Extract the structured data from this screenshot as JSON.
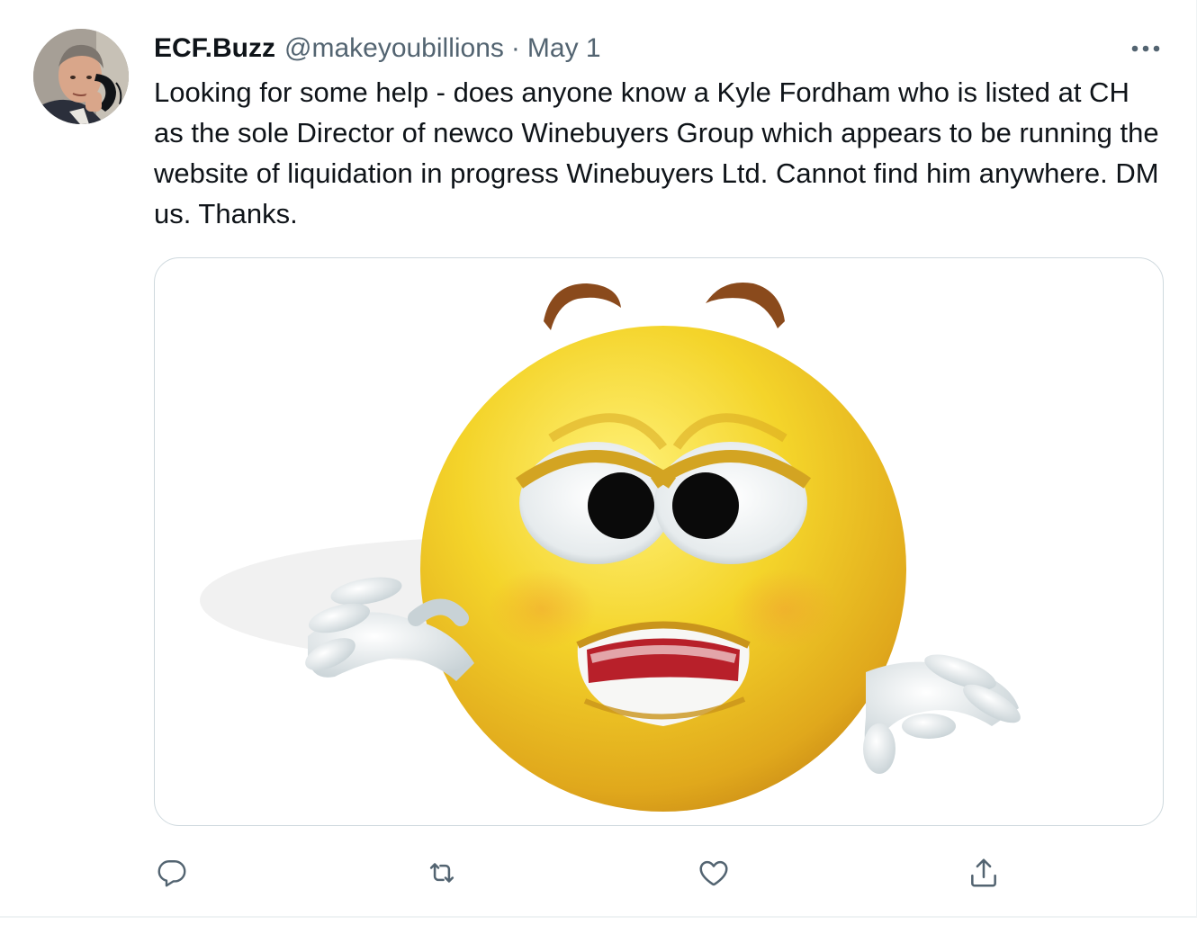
{
  "tweet": {
    "display_name": "ECF.Buzz",
    "handle": "@makeyoubillions",
    "separator": "·",
    "date": "May 1",
    "text": "Looking for some help - does anyone know a Kyle Fordham who is listed at CH as the sole Director of newco Winebuyers Group which appears to be running the website of liquidation in progress Winebuyers Ltd. Cannot find him anywhere. DM us. Thanks."
  },
  "actions": {
    "reply": "reply-icon",
    "retweet": "retweet-icon",
    "like": "heart-icon",
    "share": "share-icon"
  },
  "colors": {
    "text": "#0f1419",
    "secondary": "#536471",
    "icon": "#536471",
    "border": "#cfd9de"
  }
}
